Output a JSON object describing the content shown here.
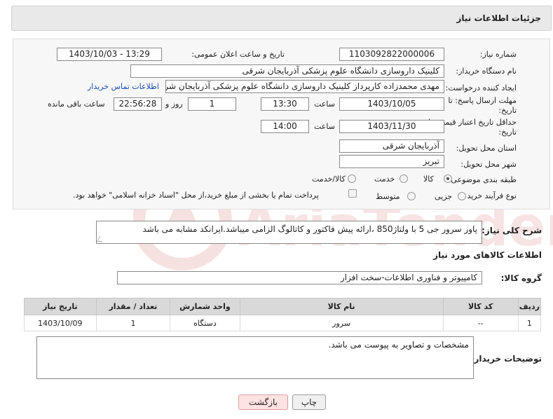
{
  "header": {
    "title": "جزئیات اطلاعات نیاز"
  },
  "form": {
    "need_number": {
      "label": "شماره نیاز:",
      "value": "1103092822000006"
    },
    "announce": {
      "label": "تاریخ و ساعت اعلان عمومی:",
      "value": "1403/10/03 - 13:29"
    },
    "buyer_org": {
      "label": "نام دستگاه خریدار:",
      "value": "کلینیک داروسازی دانشگاه علوم پزشکی آذربایجان شرقی"
    },
    "creator": {
      "label": "ایجاد کننده درخواست:",
      "value": "مهدی محمدزاده کارپرداز کلینیک داروسازی دانشگاه علوم پزشکی آذربایجان شرقی",
      "contact_link": "اطلاعات تماس خریدار"
    },
    "reply_deadline": {
      "label_line1": "مهلت ارسال پاسخ: تا",
      "label_line2": "تاریخ:",
      "date": "1403/10/05",
      "time_label": "ساعت",
      "time": "13:30",
      "days": "1",
      "days_label": "روز و",
      "remaining": "22:56:28",
      "remaining_label": "ساعت باقی مانده"
    },
    "price_validity": {
      "label_line1": "حداقل تاریخ اعتبار قیمت: تا",
      "label_line2": "تاریخ:",
      "date": "1403/11/30",
      "time_label": "ساعت",
      "time": "14:00"
    },
    "province": {
      "label": "استان محل تحویل:",
      "value": "آذربایجان شرقی"
    },
    "city": {
      "label": "شهر محل تحویل:",
      "value": "تبریز"
    },
    "category": {
      "label": "طبقه بندی موضوعی:",
      "options": [
        "کالا",
        "خدمت",
        "کالا/خدمت"
      ],
      "selected": "کالا"
    },
    "process": {
      "label": "نوع فرآیند خرید :",
      "options": [
        "جزیی",
        "متوسط"
      ],
      "selected": "",
      "checkbox_text": "پرداخت تمام یا بخشی از مبلغ خرید،از محل \"اسناد خزانه اسلامی\" خواهد بود."
    }
  },
  "description": {
    "label": "شرح کلی نیاز:",
    "value": "پاور سرور جی 5 با ولتاژ850 ،ارائه پیش فاکتور و کاتالوگ الزامی میباشد.ایرانکد مشابه می باشد"
  },
  "goods_section": {
    "title": "اطلاعات کالاهای مورد نیاز",
    "group_label": "گروه کالا:",
    "group_value": "کامپیوتر و فناوری اطلاعات-سخت افزار"
  },
  "table": {
    "headers": [
      "ردیف",
      "کد کالا",
      "نام کالا",
      "واحد شمارش",
      "تعداد / مقدار",
      "تاریخ نیاز"
    ],
    "rows": [
      [
        "1",
        "--",
        "سرور",
        "دستگاه",
        "1",
        "1403/10/09"
      ]
    ]
  },
  "buyer_notes": {
    "label": "توضیحات خریدار:",
    "value": "مشخصات و تصاویر به پیوست می باشد."
  },
  "buttons": {
    "print": "چاپ",
    "back": "بازگشت"
  },
  "watermark": {
    "text": "AriaTender.neT"
  }
}
